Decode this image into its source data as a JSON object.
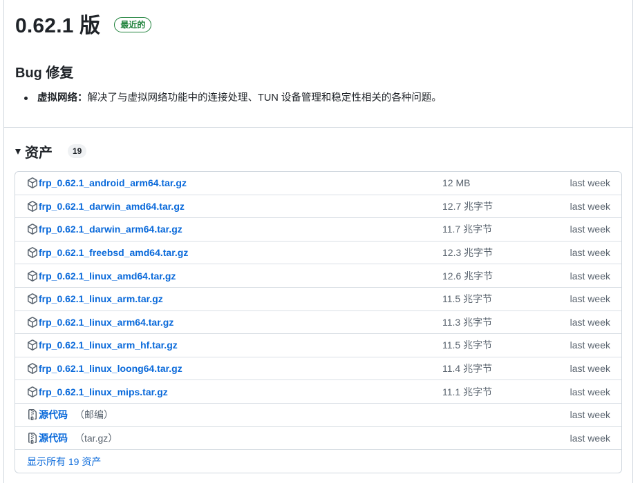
{
  "release": {
    "version": "0.62.1 版",
    "badge": "最近的"
  },
  "notes": {
    "heading": "Bug 修复",
    "items": [
      {
        "title": "虚拟网络：",
        "text": "解决了与虚拟网络功能中的连接处理、TUN 设备管理和稳定性相关的各种问题。"
      }
    ]
  },
  "assets": {
    "label": "资产",
    "count": "19",
    "files": [
      {
        "name": "frp_0.62.1_android_arm64.tar.gz",
        "size": "12 MB",
        "date": "last week"
      },
      {
        "name": "frp_0.62.1_darwin_amd64.tar.gz",
        "size": "12.7 兆字节",
        "date": "last week"
      },
      {
        "name": "frp_0.62.1_darwin_arm64.tar.gz",
        "size": "11.7 兆字节",
        "date": "last week"
      },
      {
        "name": "frp_0.62.1_freebsd_amd64.tar.gz",
        "size": "12.3 兆字节",
        "date": "last week"
      },
      {
        "name": "frp_0.62.1_linux_amd64.tar.gz",
        "size": "12.6 兆字节",
        "date": "last week"
      },
      {
        "name": "frp_0.62.1_linux_arm.tar.gz",
        "size": "11.5 兆字节",
        "date": "last week"
      },
      {
        "name": "frp_0.62.1_linux_arm64.tar.gz",
        "size": "11.3 兆字节",
        "date": "last week"
      },
      {
        "name": "frp_0.62.1_linux_arm_hf.tar.gz",
        "size": "11.5 兆字节",
        "date": "last week"
      },
      {
        "name": "frp_0.62.1_linux_loong64.tar.gz",
        "size": "11.4 兆字节",
        "date": "last week"
      },
      {
        "name": "frp_0.62.1_linux_mips.tar.gz",
        "size": "11.1 兆字节",
        "date": "last week"
      }
    ],
    "sources": [
      {
        "name": "源代码",
        "suffix": "（邮编）",
        "date": "last week"
      },
      {
        "name": "源代码",
        "suffix": "（tar.gz）",
        "date": "last week"
      }
    ],
    "show_all": "显示所有 19 资产"
  },
  "icons": {
    "package": "package-icon",
    "zip": "file-zip-icon",
    "triangle": "triangle-down-icon"
  },
  "colors": {
    "link": "#0969da",
    "muted": "#59636e",
    "badge": "#1a7f37",
    "border": "#d0d7de"
  }
}
